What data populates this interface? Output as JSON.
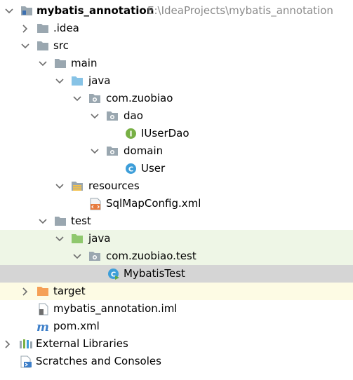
{
  "tree": {
    "project": {
      "name": "mybatis_annotation",
      "path": "E:\\IdeaProjects\\mybatis_annotation",
      "icon": "project-folder-icon"
    },
    "items": [
      {
        "label": "mybatis_annotation",
        "icon": "project-folder-icon",
        "expanded": true
      },
      {
        "label": ".idea",
        "icon": "folder-icon",
        "expanded": false
      },
      {
        "label": "src",
        "icon": "folder-icon",
        "expanded": true
      },
      {
        "label": "main",
        "icon": "folder-icon",
        "expanded": true
      },
      {
        "label": "java",
        "icon": "source-root-folder-icon",
        "expanded": true
      },
      {
        "label": "com.zuobiao",
        "icon": "package-icon",
        "expanded": true
      },
      {
        "label": "dao",
        "icon": "package-icon",
        "expanded": true
      },
      {
        "label": "IUserDao",
        "icon": "interface-icon"
      },
      {
        "label": "domain",
        "icon": "package-icon",
        "expanded": true
      },
      {
        "label": "User",
        "icon": "class-icon"
      },
      {
        "label": "resources",
        "icon": "resources-folder-icon",
        "expanded": true
      },
      {
        "label": "SqlMapConfig.xml",
        "icon": "xml-file-icon"
      },
      {
        "label": "test",
        "icon": "folder-icon",
        "expanded": true
      },
      {
        "label": "java",
        "icon": "test-source-root-folder-icon",
        "expanded": true
      },
      {
        "label": "com.zuobiao.test",
        "icon": "package-icon",
        "expanded": true
      },
      {
        "label": "MybatisTest",
        "icon": "test-class-icon",
        "selected": true
      },
      {
        "label": "target",
        "icon": "excluded-folder-icon",
        "expanded": false
      },
      {
        "label": "mybatis_annotation.iml",
        "icon": "iml-file-icon"
      },
      {
        "label": "pom.xml",
        "icon": "maven-pom-icon"
      },
      {
        "label": "External Libraries",
        "icon": "external-libraries-icon",
        "expanded": false
      },
      {
        "label": "Scratches and Consoles",
        "icon": "scratches-icon"
      }
    ]
  },
  "colors": {
    "folder": "#9aa7b0",
    "source_root": "#87c3e6",
    "test_source_root": "#8fc86d",
    "excluded": "#f5a056",
    "class": "#3d9ed9",
    "interface": "#78b045",
    "test_row_bg": "#eef6e6",
    "selected_row_bg": "#d5d5d5",
    "excluded_row_bg": "#fdfbe4",
    "path_text": "#8a8a8a"
  }
}
